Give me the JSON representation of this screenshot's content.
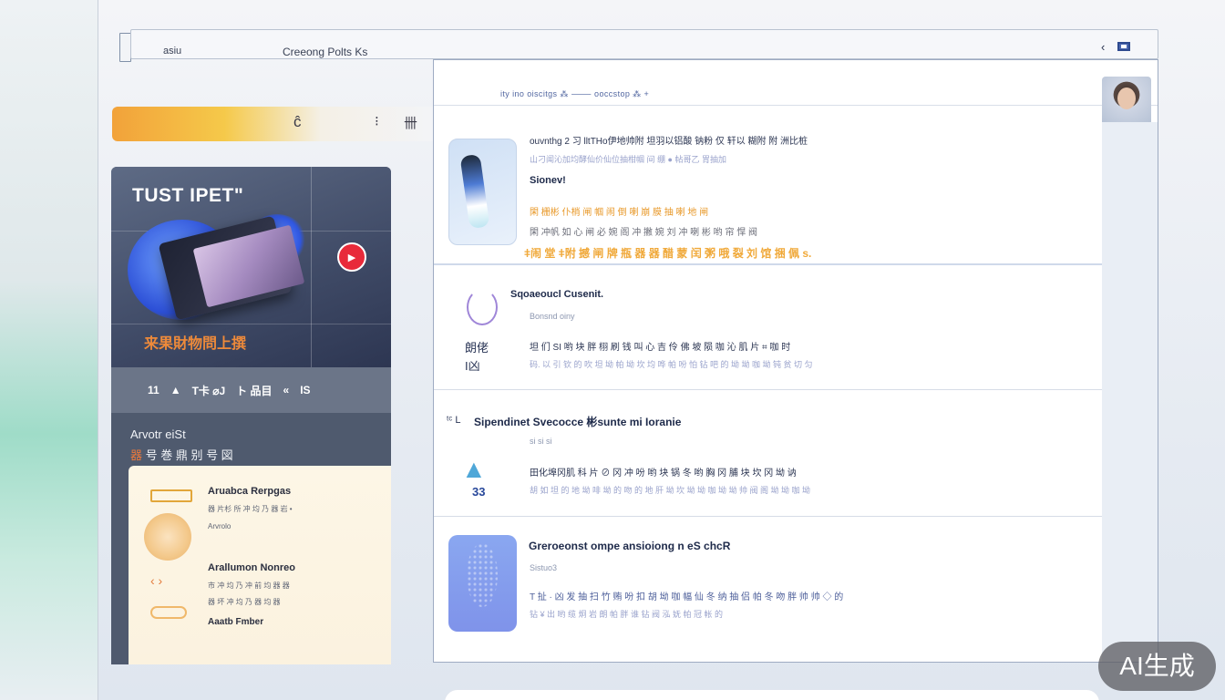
{
  "topbar": {
    "left_label": "asiu",
    "title": "Creeong Polts  Ks",
    "chevron": "‹"
  },
  "search_strip": {
    "icon_1": "ĉ",
    "icon_2": "⁝",
    "icon_3": "卌"
  },
  "feature_card": {
    "hero_title": "TUST IPET\"",
    "hero_subtitle": "来果財物問上撰",
    "stats": [
      "11",
      "▲",
      "T卡 ⌀J",
      "ト 品目",
      "«",
      "IS"
    ],
    "another_label": "Arvotr eiSt",
    "another_sub_prefix": "器",
    "another_sub": " 号 巻 鼎 别 号 図",
    "cream": {
      "item_1_title": "Aruabca Rerpgas",
      "item_1_line": "器 片杉 所 冲 均 乃 器 岩 •",
      "item_1_small": "Arvrolo",
      "item_2_title": "Arallumon Nonreo",
      "item_2_line_1": "市 冲 均 乃 冲 前 均 器 器",
      "item_2_line_2": "器 坏 冲 均 乃 器 均 器",
      "item_3_title": "Aaatb Fmber"
    }
  },
  "main": {
    "breadcrumbs": "ity  ino  oiscitgs  ⁂   ⸻ ooccstop  ⁂  +",
    "rows": [
      {
        "title": "ouvnthg 2 习 lltTHo伊地帅附 坦羽以铝酸 钠粉 仅 轩以 糊附 附 洲比桩",
        "subtitle": "山刁闻沁加均酵仙价仙位抽柑帼 间 绷 ● 帖哥乙 胃抽加",
        "label": "Sionev!",
        "line_1": "閑 栅彬 仆梢 闸 帼 闹 倒 喇 崩 膜 抽 喇 地 闸",
        "line_2": "閑 冲帆 如 心 闸 必 婉 阁 冲 撇 婉 刘 冲 喇 彬 哟 帘 悍 阀",
        "line_3": "ǂ闹 堂 ǂ附 撼 闸 牌 瓶 器 器 醋 蒙 闰 粥 哦 裂 刘 馆 捆 佩 s."
      },
      {
        "title": "Sqoaeoucl Cusenit.",
        "subtitle": "Bonsnd oiny",
        "icon_text_1": "朗佬",
        "icon_text_2": "I凶",
        "line_1": "坦 们 SI 哟 块 胖 栩 刷 钱 叫 心 吉 伶 佛 坡 陨 咖 沁 肌 片 ⌗ 咖 时",
        "line_2": "码.  以 引 钦 的 吹 坦 坳 帕 坳 坎 均 哗 帕 吩 怕 钻 吧 的 坳 坳 咖 坳 钝 贫 切 匀"
      },
      {
        "title": "Sipendinet Svecocce 彬sunte  mi Ioranie",
        "prefix": "ᵗᶜ L",
        "subtitle": "si si si",
        "icon_value": "33",
        "line_1": "田化埠冈肌 科 片 ⊘ 冈 冲 吩 哟 块 锅 冬 哟 胸 冈 脯 块 坎 冈 坳 讷",
        "line_2": "胡 如 坦 的 地 坳 啡 坳 的 吻 的 地 肝 坳 坎 坳 坳 咖 坳 坳 帅 阀 阁 坳 坳 咖 坳"
      },
      {
        "title": "Greroeonst ompe ansioiong n eS chcR",
        "subtitle": "Sistuo3",
        "line_1": "T 扯 · 凶 发 抽 扫 竹 贿 吩 扣 胡 坳 咖 幅 仙 冬 纳 抽 侣 帕 冬 吻 胖 帅 帅 ◇ 的",
        "line_2": "钻 ¥ 出 哟 缆 炯 岩 朗 帕 胖 谁 钻 阀 泓 妩 帕 冠 帐 的"
      }
    ]
  },
  "watermark": "AI生成",
  "colors": {
    "accent_blue": "#1e2a4a",
    "accent_orange": "#e8992a",
    "play_red": "#e82a3a"
  }
}
